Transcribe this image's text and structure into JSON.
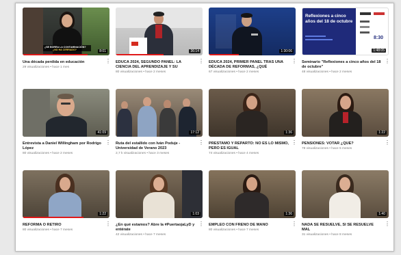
{
  "videos": [
    {
      "title": "Una década perdida en educación",
      "meta": "29 visualizaciones • hace 1 mes",
      "duration": "8:01",
      "progress": 0.75,
      "overlay_line1": "¿SE BORRA LA CONTAMINACIÓN?",
      "overlay_line2": "¿NO HA CERRADO?"
    },
    {
      "title": "EDUCA 2024, SEGUNDO PANEL: LA CIENCIA DEL APRENDIZAJE Y SU IMPORTANCIA...",
      "meta": "80 visualizaciones • hace 2 meses",
      "duration": "36:14",
      "progress": 0.55
    },
    {
      "title": "EDUCA 2024, PRIMER PANEL TRAS UNA DÉCADA DE REFORMAS, ¿QUÉ NECESITA...",
      "meta": "67 visualizaciones • hace 2 meses",
      "duration": "1:30:06",
      "progress": 0.35
    },
    {
      "title": "Seminario \"Reflexiones a cinco años del 18 de octubre\"",
      "meta": "48 visualizaciones • hace 2 meses",
      "duration": "1:48:05",
      "progress": 0,
      "slide_title": "Reflexiones a cinco años del 18 de octubre",
      "slide_time": "8:30"
    },
    {
      "title": "Entrevista a Daniel Willingham por Rodrigo López",
      "meta": "80 visualizaciones • hace 2 meses",
      "duration": "41:09",
      "progress": 0
    },
    {
      "title": "Ruta del estallido con Iván Poduje - Universidad de Verano 2023",
      "meta": "2,7 k visualizaciones • hace 3 meses",
      "duration": "17:12",
      "progress": 0
    },
    {
      "title": "PRÉSTAMO Y REPARTO: NO ES LO MISMO, PERO ES IGUAL",
      "meta": "74 visualizaciones • hace 4 meses",
      "duration": "1:36",
      "progress": 0
    },
    {
      "title": "PENSIONES: VOTAR ¿QUÉ?",
      "meta": "78 visualizaciones • hace 5 meses",
      "duration": "1:22",
      "progress": 0
    },
    {
      "title": "REFORMA O RETIRO",
      "meta": "80 visualizaciones • hace 7 meses",
      "duration": "1:22",
      "progress": 0.7
    },
    {
      "title": "¿En qué estamos? Abre la #PuertaojaLyD y entérate",
      "meta": "42 visualizaciones • hace 7 meses",
      "duration": "1:03",
      "progress": 0
    },
    {
      "title": "EMPLEO CON FRENO DE MANO",
      "meta": "80 visualizaciones • hace 7 meses",
      "duration": "1:36",
      "progress": 0
    },
    {
      "title": "NADA SE RESUELVE, SI SE RESUELVE MAL",
      "meta": "31 visualizaciones • hace 8 meses",
      "duration": "1:40",
      "progress": 0
    }
  ],
  "menu_glyph": "⋮"
}
